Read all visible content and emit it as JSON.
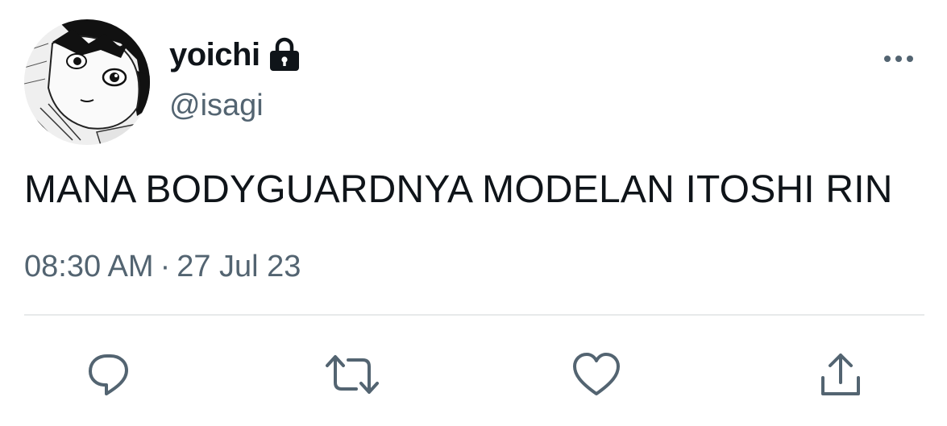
{
  "tweet": {
    "display_name": "yoichi",
    "handle": "@isagi",
    "text": "MANA BODYGUARDNYA MODELAN ITOSHI RIN",
    "time": "08:30 AM",
    "separator": "·",
    "date": "27 Jul 23"
  },
  "icons": {
    "lock": "lock-icon",
    "more": "more-horizontal-icon",
    "reply": "reply-icon",
    "retweet": "retweet-icon",
    "like": "heart-icon",
    "share": "share-icon"
  },
  "colors": {
    "text_primary": "#0f1419",
    "text_secondary": "#536471",
    "divider": "#e7e9ea"
  }
}
